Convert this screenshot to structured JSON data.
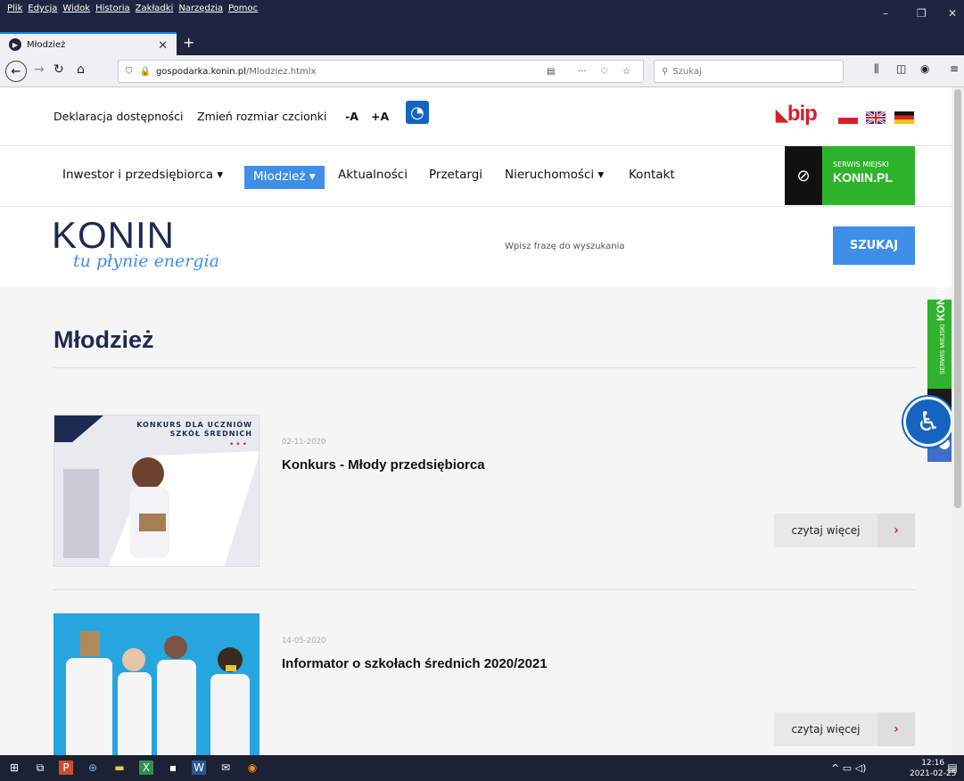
{
  "browser": {
    "menu": [
      "Plik",
      "Edycja",
      "Widok",
      "Historia",
      "Zakładki",
      "Narzędzia",
      "Pomoc"
    ],
    "tab_title": "Młodzież",
    "url_host": "gospodarka.konin.pl",
    "url_path": "/Mlodziez.htmlx",
    "search_placeholder": "Szukaj",
    "win_min": "–",
    "win_max": "❐",
    "win_close": "✕"
  },
  "top": {
    "accessibility_decl": "Deklaracja dostępności",
    "font_resize": "Zmień rozmiar czcionki",
    "font_minus": "-A",
    "font_plus": "+A",
    "bip": "bip"
  },
  "nav": {
    "items": [
      {
        "label": "Inwestor i przedsiębiorca ▾"
      },
      {
        "label": "Młodzież ▾"
      },
      {
        "label": "Aktualności"
      },
      {
        "label": "Przetargi"
      },
      {
        "label": "Nieruchomości ▾"
      },
      {
        "label": "Kontakt"
      }
    ],
    "serwis_small": "SERWIS MIEJSKI",
    "serwis_big": "KONIN.PL"
  },
  "logo": {
    "name": "KONIN",
    "tagline": "tu płynie energia"
  },
  "search": {
    "placeholder": "Wpisz frazę do wyszukania",
    "button": "SZUKAJ"
  },
  "page_title": "Młodzież",
  "articles": [
    {
      "date": "02-11-2020",
      "title": "Konkurs - Młody przedsiębiorca",
      "image_caption": "KONKURS DLA UCZNIÓW SZKÓŁ ŚREDNICH",
      "more": "czytaj więcej"
    },
    {
      "date": "14-05-2020",
      "title": "Informator o szkołach średnich 2020/2021",
      "more": "czytaj więcej"
    }
  ],
  "side_banner": {
    "small": "SERWIS MIEJSKI",
    "big": "KONIN.PL"
  },
  "taskbar": {
    "time": "12:16",
    "date": "2021-02-25"
  }
}
